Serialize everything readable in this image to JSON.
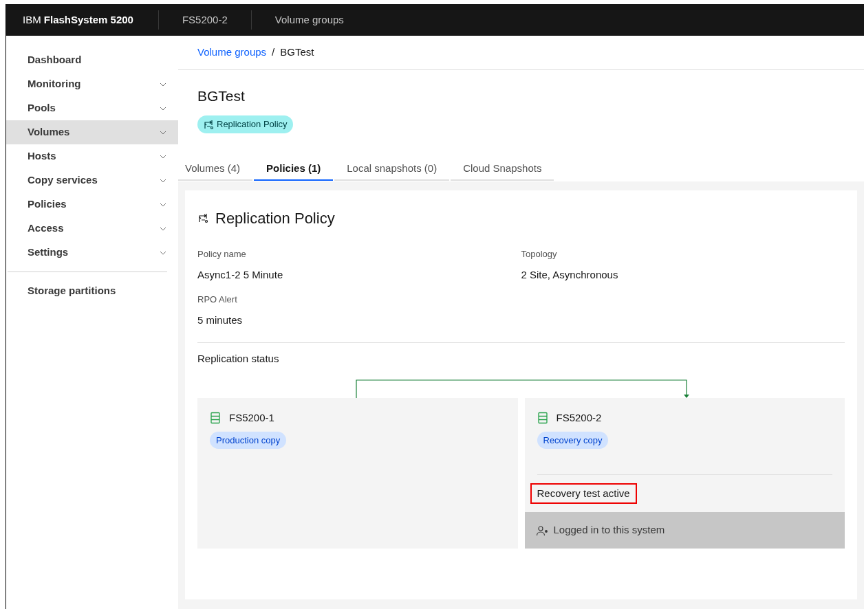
{
  "header": {
    "product_prefix": "IBM",
    "product_name": "FlashSystem 5200",
    "system": "FS5200-2",
    "page": "Volume groups"
  },
  "sidebar": {
    "items": [
      {
        "label": "Dashboard",
        "expandable": false,
        "selected": false
      },
      {
        "label": "Monitoring",
        "expandable": true,
        "selected": false
      },
      {
        "label": "Pools",
        "expandable": true,
        "selected": false
      },
      {
        "label": "Volumes",
        "expandable": true,
        "selected": true
      },
      {
        "label": "Hosts",
        "expandable": true,
        "selected": false
      },
      {
        "label": "Copy services",
        "expandable": true,
        "selected": false
      },
      {
        "label": "Policies",
        "expandable": true,
        "selected": false
      },
      {
        "label": "Access",
        "expandable": true,
        "selected": false
      },
      {
        "label": "Settings",
        "expandable": true,
        "selected": false
      }
    ],
    "bottom_items": [
      {
        "label": "Storage partitions"
      }
    ]
  },
  "breadcrumb": {
    "link": "Volume groups",
    "separator": "/",
    "current": "BGTest"
  },
  "title": "BGTest",
  "tag": "Replication Policy",
  "tabs": [
    {
      "label": "Volumes (4)",
      "selected": false
    },
    {
      "label": "Policies (1)",
      "selected": true
    },
    {
      "label": "Local snapshots (0)",
      "selected": false
    },
    {
      "label": "Cloud Snapshots",
      "selected": false
    }
  ],
  "policy": {
    "heading": "Replication Policy",
    "fields": [
      {
        "label": "Policy name",
        "value": "Async1-2 5 Minute"
      },
      {
        "label": "Topology",
        "value": "2 Site, Asynchronous"
      },
      {
        "label": "RPO Alert",
        "value": "5 minutes"
      }
    ],
    "status_label": "Replication status",
    "systems": [
      {
        "name": "FS5200-1",
        "tag": "Production copy"
      },
      {
        "name": "FS5200-2",
        "tag": "Recovery copy",
        "status": "Recovery test active",
        "footer": "Logged in to this system"
      }
    ]
  }
}
